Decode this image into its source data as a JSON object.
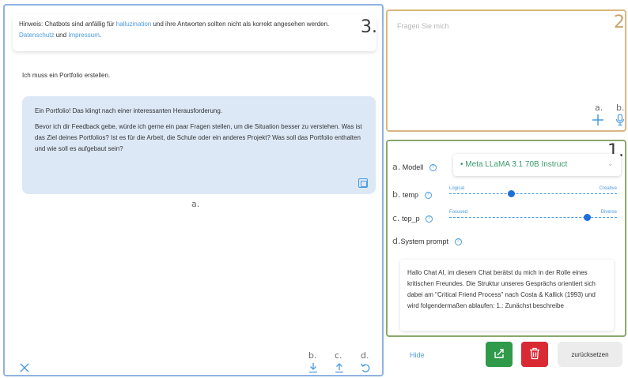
{
  "chat": {
    "notice": {
      "prefix": "Hinweis: Chatbots sind anfällig für",
      "link_hallucination": "halluzination",
      "middle": "und ihre Antworten sollten nicht als korrekt angesehen werden.",
      "link_privacy": "Datenschutz",
      "and": "und",
      "link_imprint": "Impressum",
      "period": "."
    },
    "user_message": "Ich muss ein Portfolio erstellen.",
    "bot_message": {
      "p1": "Ein Portfolio! Das klingt nach einer interessanten Herausforderung.",
      "p2": "Bevor ich dir Feedback gebe, würde ich gerne ein paar Fragen stellen, um die Situation besser zu verstehen. Was ist das Ziel deines Portfolios? Ist es für die Arbeit, die Schule oder ein anderes Projekt? Was soll das Portfolio enthalten und wie soll es aufgebaut sein?"
    },
    "markers": {
      "panel": "3.",
      "a": "a.",
      "b": "b.",
      "c": "c.",
      "d": "d."
    }
  },
  "input": {
    "placeholder": "Fragen Sie mich",
    "marker": "2",
    "marker_a": "a.",
    "marker_b": "b."
  },
  "settings": {
    "marker": "1.",
    "model": {
      "letter": "a.",
      "label": "Modell",
      "value": "Meta LLaMA 3.1 70B Instruct"
    },
    "temp": {
      "letter": "b.",
      "label": "temp",
      "left": "Logical",
      "right": "Creative",
      "value": 0.37
    },
    "top_p": {
      "letter": "c.",
      "label": "top_p",
      "left": "Focused",
      "right": "Diverse",
      "value": 0.82
    },
    "system": {
      "letter": "d.",
      "label": "System prompt",
      "text": "Hallo Chat AI, im diesem Chat berätst du mich in der Rolle eines kritischen Freundes. Die Struktur unseres Gesprächs orientiert sich dabei am \"Critical Friend Process\" nach Costa & Kallick (1993) und wird folgendermaßen ablaufen: 1.: Zunächst beschreibe"
    }
  },
  "buttons": {
    "hide": "Hide",
    "reset": "zurücksetzen"
  },
  "colors": {
    "chat_border": "#8fb3e3",
    "input_border": "#d9b77e",
    "settings_border": "#8aa86c",
    "accent": "#4a9be0",
    "share": "#2f9a4a",
    "delete": "#d92a34"
  }
}
